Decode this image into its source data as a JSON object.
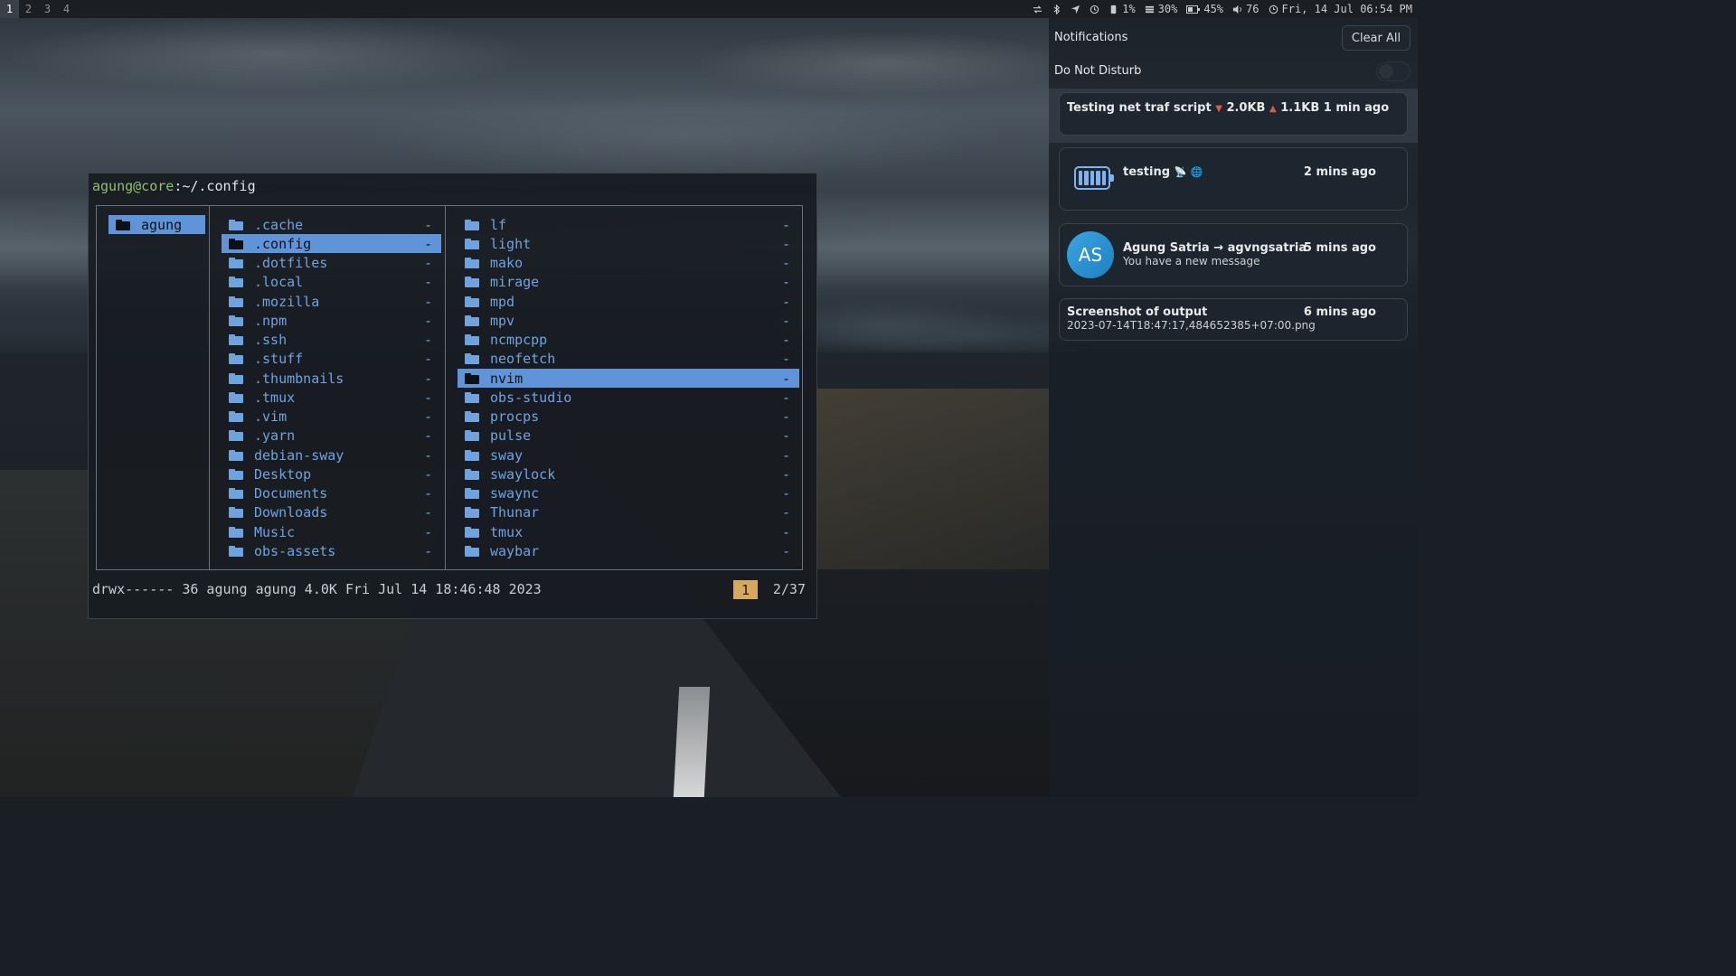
{
  "workspaces": [
    "1",
    "2",
    "3",
    "4"
  ],
  "active_workspace": "1",
  "tray": {
    "cpu": "1%",
    "memory": "30%",
    "battery": "45%",
    "volume": "76",
    "clock": "Fri, 14 Jul 06:54 PM",
    "icons": [
      "network-transfer-icon",
      "bluetooth-icon",
      "send-icon",
      "idle-inhibitor-icon",
      "cpu-icon",
      "memory-icon",
      "battery-icon",
      "volume-icon",
      "clock-icon"
    ]
  },
  "terminal": {
    "prompt_user": "agung@core",
    "prompt_sep": ":",
    "prompt_path": "~/.config",
    "pane1": [
      {
        "name": "agung",
        "selected": true
      }
    ],
    "pane2": [
      {
        "name": ".cache",
        "size": "-"
      },
      {
        "name": ".config",
        "size": "-",
        "selected": true
      },
      {
        "name": ".dotfiles",
        "size": "-"
      },
      {
        "name": ".local",
        "size": "-"
      },
      {
        "name": ".mozilla",
        "size": "-"
      },
      {
        "name": ".npm",
        "size": "-"
      },
      {
        "name": ".ssh",
        "size": "-"
      },
      {
        "name": ".stuff",
        "size": "-"
      },
      {
        "name": ".thumbnails",
        "size": "-"
      },
      {
        "name": ".tmux",
        "size": "-"
      },
      {
        "name": ".vim",
        "size": "-"
      },
      {
        "name": ".yarn",
        "size": "-"
      },
      {
        "name": "debian-sway",
        "size": "-"
      },
      {
        "name": "Desktop",
        "size": "-"
      },
      {
        "name": "Documents",
        "size": "-"
      },
      {
        "name": "Downloads",
        "size": "-"
      },
      {
        "name": "Music",
        "size": "-"
      },
      {
        "name": "obs-assets",
        "size": "-"
      }
    ],
    "pane3": [
      {
        "name": "lf",
        "size": "-"
      },
      {
        "name": "light",
        "size": "-"
      },
      {
        "name": "mako",
        "size": "-"
      },
      {
        "name": "mirage",
        "size": "-"
      },
      {
        "name": "mpd",
        "size": "-"
      },
      {
        "name": "mpv",
        "size": "-"
      },
      {
        "name": "ncmpcpp",
        "size": "-"
      },
      {
        "name": "neofetch",
        "size": "-"
      },
      {
        "name": "nvim",
        "size": "-",
        "selected": true
      },
      {
        "name": "obs-studio",
        "size": "-"
      },
      {
        "name": "procps",
        "size": "-"
      },
      {
        "name": "pulse",
        "size": "-"
      },
      {
        "name": "sway",
        "size": "-"
      },
      {
        "name": "swaylock",
        "size": "-"
      },
      {
        "name": "swaync",
        "size": "-"
      },
      {
        "name": "Thunar",
        "size": "-"
      },
      {
        "name": "tmux",
        "size": "-"
      },
      {
        "name": "waybar",
        "size": "-"
      }
    ],
    "status_line": "drwx------ 36 agung agung 4.0K Fri Jul 14 18:46:48 2023",
    "badge": "1",
    "position": "2/37"
  },
  "notifications": {
    "title": "Notifications",
    "clear_all": "Clear All",
    "dnd_label": "Do Not Disturb",
    "items": [
      {
        "title": "Testing net traf script",
        "down_arrow": "▼",
        "down": "2.0KB",
        "up_arrow": "▲",
        "up": "1.1KB",
        "time": "1 min ago"
      },
      {
        "title": "testing",
        "time": "2 mins ago",
        "icons": [
          "satellite-icon",
          "globe-icon"
        ]
      },
      {
        "avatar": "AS",
        "title": "Agung Satria → agvngsatria",
        "body": "You have a new message",
        "time": "5 mins ago"
      },
      {
        "title": "Screenshot of output",
        "body": "2023-07-14T18:47:17,484652385+07:00.png",
        "time": "6 mins ago"
      }
    ]
  },
  "colors": {
    "accent": "#5f95d8",
    "folder": "#6fa3e0",
    "prompt_user": "#8fc06b",
    "badge": "#d6a85c"
  }
}
